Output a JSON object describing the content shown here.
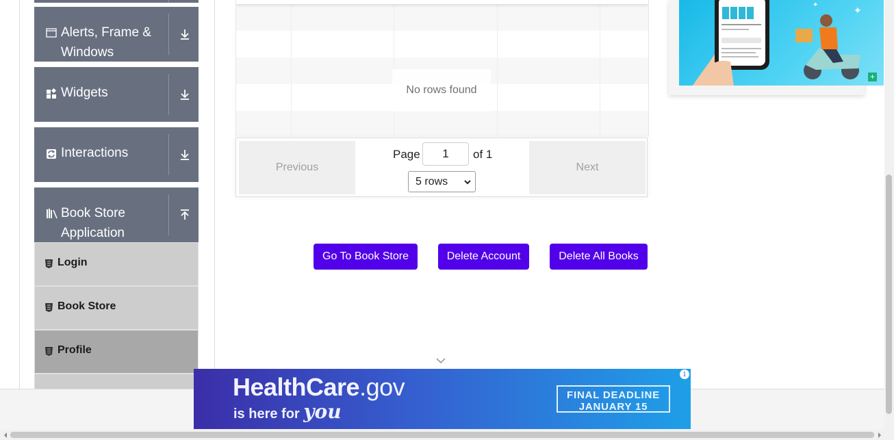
{
  "sidebar": {
    "groups": [
      {
        "label": "Alerts, Frame & Windows",
        "icon": "window-icon",
        "expanded": false
      },
      {
        "label": "Widgets",
        "icon": "widgets-icon",
        "expanded": false
      },
      {
        "label": "Interactions",
        "icon": "interactions-icon",
        "expanded": false
      },
      {
        "label": "Book Store Application",
        "icon": "books-icon",
        "expanded": true
      }
    ],
    "alerts_label_line1": "Alerts, Frame &",
    "alerts_label_line2": "Windows",
    "bookstore_label_line1": "Book Store",
    "bookstore_label_line2": "Application",
    "items": [
      {
        "label": "Login",
        "icon": "html5-icon",
        "active": false
      },
      {
        "label": "Book Store",
        "icon": "html5-icon",
        "active": false
      },
      {
        "label": "Profile",
        "icon": "html5-icon",
        "active": true
      }
    ]
  },
  "table": {
    "empty_message": "No rows found"
  },
  "pagination": {
    "previous_label": "Previous",
    "next_label": "Next",
    "page_label": "Page",
    "page_value": "1",
    "of_label": "of 1",
    "rows_select": "5 rows"
  },
  "actions": {
    "go_to_store": "Go To Book Store",
    "delete_account": "Delete Account",
    "delete_all_books": "Delete All Books"
  },
  "banner": {
    "brand": "HealthCare",
    "brand_suffix": ".gov",
    "tagline_prefix": "is here for",
    "tagline_you": "you",
    "deadline_line1": "FINAL DEADLINE",
    "deadline_line2": "JANUARY 15",
    "info_glyph": "i"
  },
  "colors": {
    "sidebar_header": "#687080",
    "menu_item": "#cdcdcd",
    "menu_item_active": "#a8a8a8",
    "action_button": "#5200ea"
  }
}
